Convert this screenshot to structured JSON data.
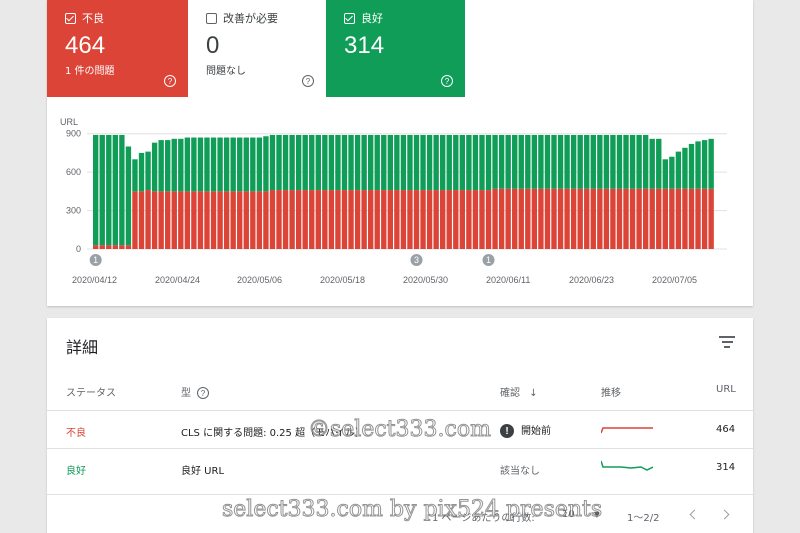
{
  "summary": {
    "poor": {
      "label": "不良",
      "count": "464",
      "sub": "1 件の問題",
      "help": "?"
    },
    "needs_improvement": {
      "label": "改善が必要",
      "count": "0",
      "sub": "問題なし",
      "help": "?"
    },
    "good": {
      "label": "良好",
      "count": "314",
      "help": "?"
    }
  },
  "colors": {
    "poor": "#db4437",
    "good": "#0f9d58",
    "needs_improvement": "#ffffff"
  },
  "chart_data": {
    "type": "bar",
    "stacked": true,
    "ylabel": "URL",
    "yticks": [
      0,
      300,
      600,
      900
    ],
    "ylim": [
      0,
      960
    ],
    "xticks": [
      "2020/04/12",
      "2020/04/24",
      "2020/05/06",
      "2020/05/18",
      "2020/05/30",
      "2020/06/11",
      "2020/06/23",
      "2020/07/05"
    ],
    "series": [
      {
        "values": [
          30,
          30,
          30,
          30,
          30,
          30,
          450,
          450,
          460,
          450,
          450,
          450,
          450,
          450,
          450,
          450,
          450,
          450,
          450,
          450,
          450,
          450,
          450,
          450,
          450,
          450,
          450,
          460,
          460,
          460,
          460,
          460,
          460,
          460,
          460,
          460,
          460,
          460,
          460,
          460,
          460,
          460,
          460,
          460,
          460,
          460,
          460,
          460,
          460,
          460,
          460,
          460,
          460,
          460,
          460,
          460,
          460,
          460,
          460,
          460,
          460,
          470,
          470,
          470,
          470,
          470,
          470,
          470,
          470,
          470,
          470,
          470,
          470,
          470,
          470,
          470,
          470,
          470,
          470,
          470,
          470,
          470,
          470,
          470,
          470,
          470,
          470,
          470,
          470,
          470,
          470,
          470,
          470,
          470,
          470
        ]
      },
      {
        "values": [
          860,
          860,
          860,
          860,
          860,
          770,
          250,
          300,
          300,
          380,
          400,
          400,
          410,
          410,
          420,
          420,
          420,
          420,
          420,
          420,
          420,
          420,
          420,
          420,
          420,
          420,
          430,
          430,
          430,
          430,
          430,
          430,
          430,
          430,
          430,
          430,
          430,
          430,
          430,
          430,
          430,
          430,
          430,
          430,
          430,
          430,
          430,
          430,
          430,
          430,
          430,
          430,
          430,
          430,
          430,
          430,
          430,
          430,
          430,
          430,
          430,
          420,
          420,
          420,
          420,
          420,
          420,
          420,
          420,
          420,
          420,
          420,
          420,
          420,
          420,
          420,
          420,
          420,
          420,
          420,
          420,
          420,
          420,
          420,
          420,
          390,
          390,
          230,
          250,
          290,
          320,
          350,
          370,
          380,
          390,
          400,
          400,
          410,
          410,
          420,
          330
        ]
      }
    ],
    "annotations": [
      {
        "index": 0,
        "label": "1"
      },
      {
        "index": 49,
        "label": "3"
      },
      {
        "index": 60,
        "label": "1"
      }
    ]
  },
  "details": {
    "title": "詳細",
    "columns": {
      "status": "ステータス",
      "type": "型",
      "type_help": "?",
      "validation": "確認",
      "trend": "推移",
      "urls": "URL"
    },
    "rows": [
      {
        "status": "不良",
        "type": "CLS に関する問題: 0.25 超（モバイル）",
        "validation": "開始前",
        "alert": "!",
        "urls": "464"
      },
      {
        "status": "良好",
        "type": "良好 URL",
        "validation": "該当なし",
        "urls": "314"
      }
    ],
    "pagination": {
      "rows_label": "1 ページあたりの行数:",
      "rows_value": "10",
      "range": "1〜2/2"
    }
  },
  "watermarks": [
    "©select333.com",
    "select333.com by pix524 presents"
  ]
}
